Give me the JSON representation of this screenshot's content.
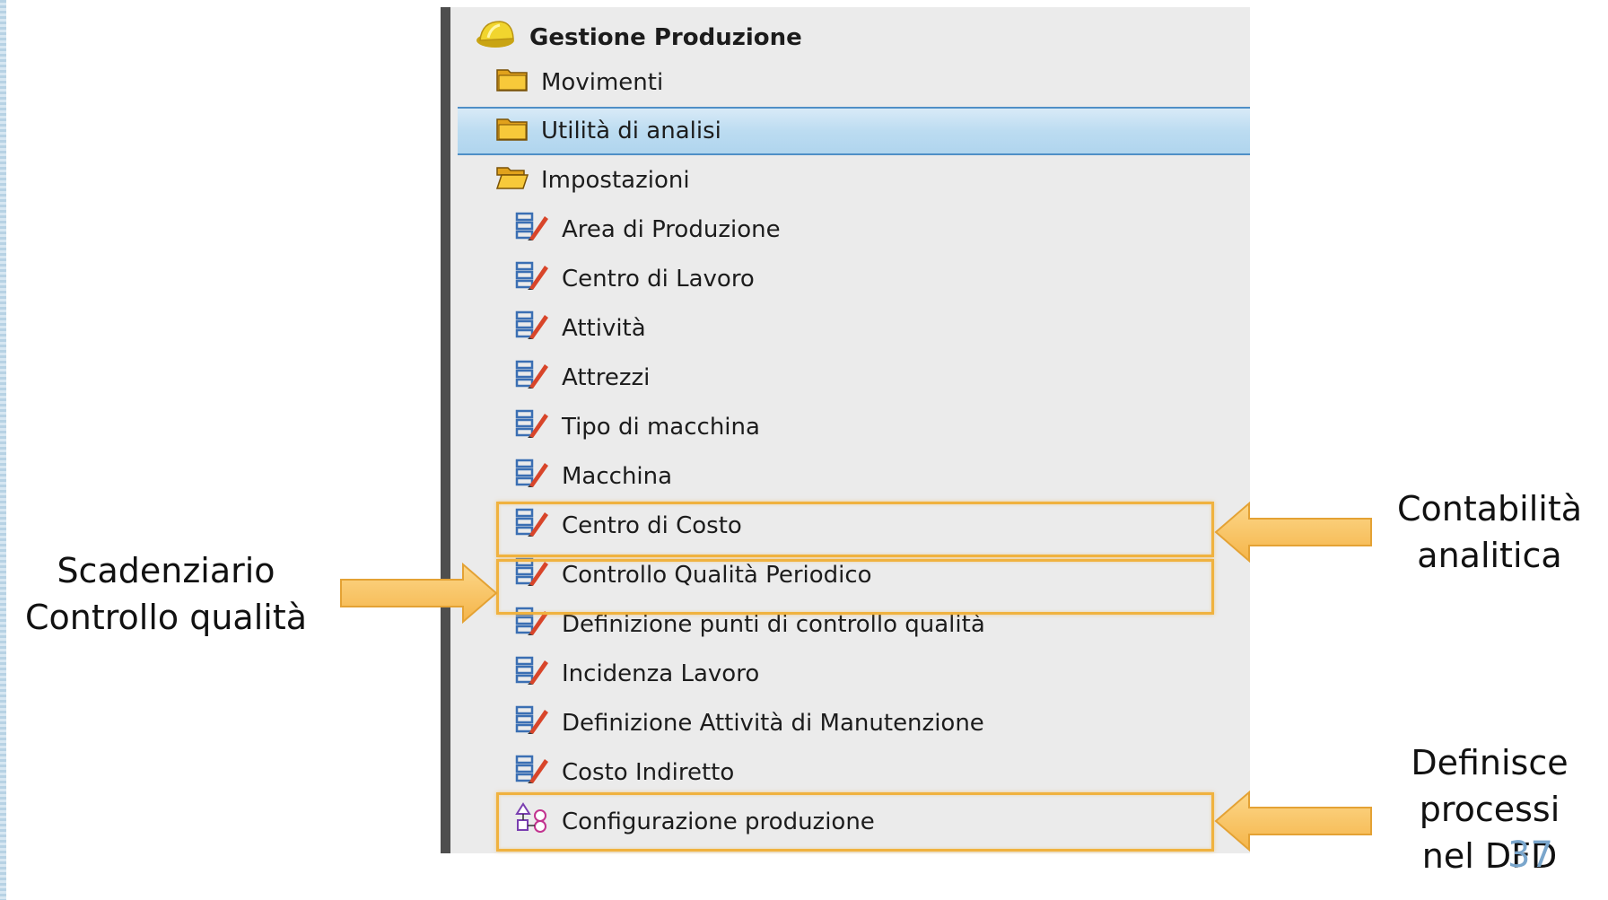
{
  "tree": {
    "root": {
      "label": "Gestione Produzione",
      "icon": "helmet-icon"
    },
    "folders": [
      {
        "label": "Movimenti",
        "icon": "folder-icon"
      },
      {
        "label": "Utilità di analisi",
        "icon": "folder-icon",
        "selected": true
      },
      {
        "label": "Impostazioni",
        "icon": "folder-open-icon"
      }
    ],
    "settings_items": [
      {
        "label": "Area di Produzione",
        "icon": "table-edit-icon"
      },
      {
        "label": "Centro di Lavoro",
        "icon": "table-edit-icon"
      },
      {
        "label": "Attività",
        "icon": "table-edit-icon"
      },
      {
        "label": "Attrezzi",
        "icon": "table-edit-icon"
      },
      {
        "label": "Tipo di macchina",
        "icon": "table-edit-icon"
      },
      {
        "label": "Macchina",
        "icon": "table-edit-icon"
      },
      {
        "label": "Centro di Costo",
        "icon": "table-edit-icon"
      },
      {
        "label": "Controllo Qualità Periodico",
        "icon": "table-edit-icon"
      },
      {
        "label": "Definizione punti di controllo qualità",
        "icon": "table-edit-icon"
      },
      {
        "label": "Incidenza Lavoro",
        "icon": "table-edit-icon"
      },
      {
        "label": "Definizione Attività di Manutenzione",
        "icon": "table-edit-icon"
      },
      {
        "label": "Costo Indiretto",
        "icon": "table-edit-icon"
      },
      {
        "label": "Configurazione produzione",
        "icon": "shapes-config-icon"
      }
    ]
  },
  "annotations": {
    "left": {
      "line1": "Scadenziario",
      "line2": "Controllo qualità"
    },
    "right_top": {
      "line1": "Contabilità",
      "line2": "analitica"
    },
    "right_bottom": {
      "line1": "Definisce",
      "line2": "processi",
      "line3": "nel DFD"
    }
  },
  "page_number": "37",
  "colors": {
    "highlight_border": "#f0b23f",
    "arrow_fill": "#f9c66d",
    "selection_border": "#4f8fc6",
    "panel_bg": "#ebebeb",
    "page_number": "#7aa6cc"
  }
}
